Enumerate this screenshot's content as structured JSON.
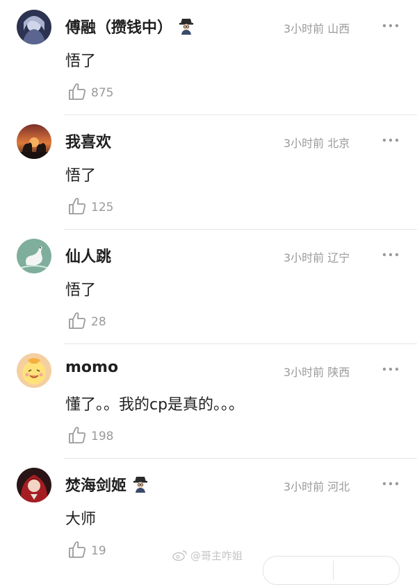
{
  "comments": [
    {
      "username": "傅融（攒钱中）",
      "has_badge": true,
      "time": "3小时前",
      "location": "山西",
      "content": "悟了",
      "likes": "875",
      "avatar_icon": "anime-avatar"
    },
    {
      "username": "我喜欢",
      "has_badge": false,
      "time": "3小时前",
      "location": "北京",
      "content": "悟了",
      "likes": "125",
      "avatar_icon": "sunset-cats-avatar"
    },
    {
      "username": "仙人跳",
      "has_badge": false,
      "time": "3小时前",
      "location": "辽宁",
      "content": "悟了",
      "likes": "28",
      "avatar_icon": "crane-avatar"
    },
    {
      "username": "momo",
      "has_badge": false,
      "time": "3小时前",
      "location": "陕西",
      "content": "懂了。。我的cp是真的。。。",
      "likes": "198",
      "avatar_icon": "cartoon-chick-avatar"
    },
    {
      "username": "焚海剑姬",
      "has_badge": true,
      "time": "3小时前",
      "location": "河北",
      "content": "大师",
      "likes": "19",
      "avatar_icon": "red-hair-avatar"
    }
  ],
  "watermark": "@哥主咋姐"
}
